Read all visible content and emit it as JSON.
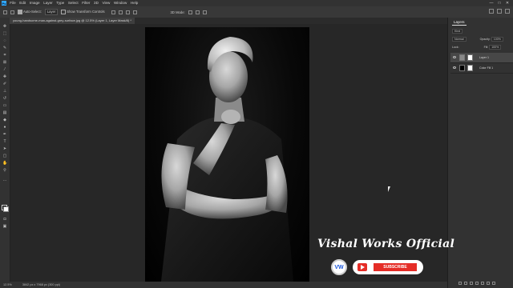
{
  "menubar": {
    "app_logo": "Ps",
    "items": [
      "File",
      "Edit",
      "Image",
      "Layer",
      "Type",
      "Select",
      "Filter",
      "3D",
      "View",
      "Window",
      "Help"
    ],
    "window_controls": [
      "—",
      "□",
      "✕"
    ]
  },
  "options": {
    "auto_select_label": "Auto-Select:",
    "auto_select_value": "Layer",
    "show_transform_label": "Show Transform Controls",
    "mode_label": "3D Mode:"
  },
  "document": {
    "tab_title": "young-handsome-man-against-grey-surface.jpg @ 12.5% (Layer 1, Layer Mask/8) *"
  },
  "status": {
    "zoom": "12.5%",
    "doc_size": "3842 px x 7968 px (300 ppi)"
  },
  "layers_panel": {
    "tab": "Layers",
    "kind_label": "Kind",
    "blend_mode": "Normal",
    "opacity_label": "Opacity:",
    "opacity_value": "100%",
    "lock_label": "Lock:",
    "fill_label": "Fill:",
    "fill_value": "100%",
    "layers": [
      {
        "name": "Layer 1",
        "selected": true
      },
      {
        "name": "Color Fill 1",
        "selected": false
      }
    ]
  },
  "overlay": {
    "channel_name": "Vishal Works Official",
    "logo_text": "VW",
    "subscribe_label": "SUBSCRIBE"
  },
  "colors": {
    "accent": "#31a8ff",
    "subscribe_red": "#e52d27",
    "panel_bg": "#323232",
    "canvas_bg": "#272727"
  }
}
